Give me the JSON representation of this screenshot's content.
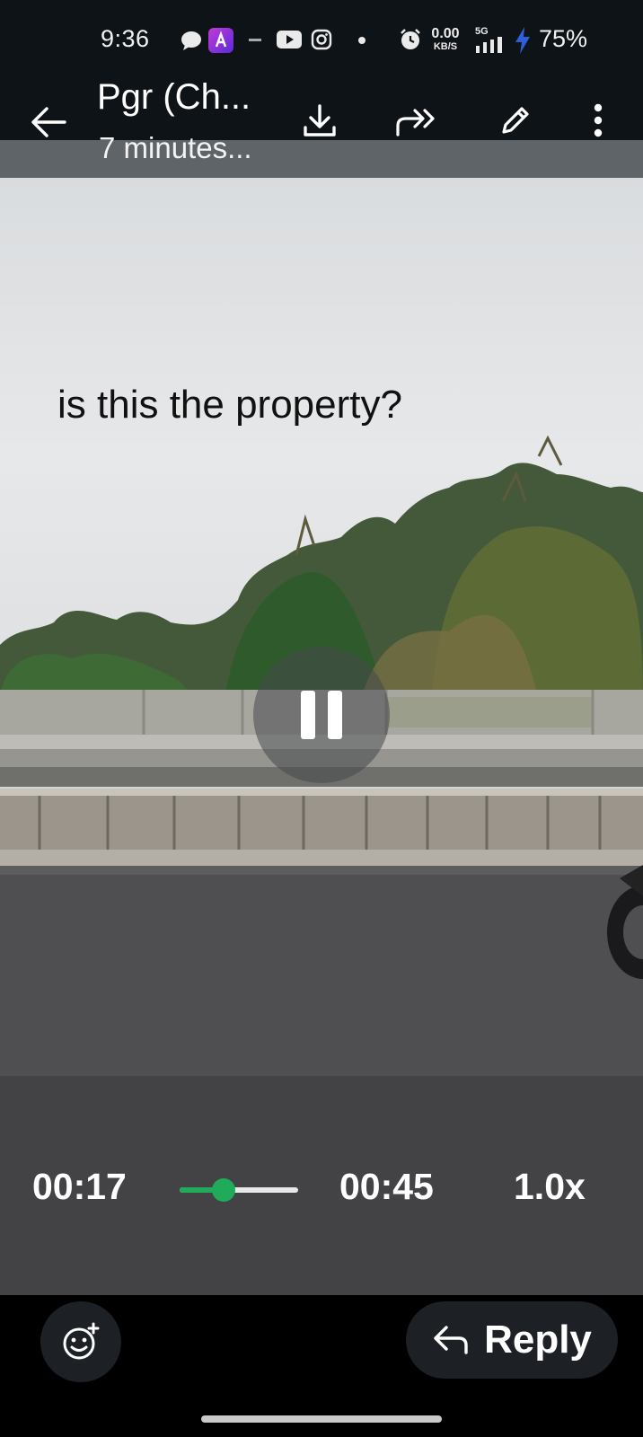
{
  "status_bar": {
    "time": "9:36",
    "network_speed": "0.00",
    "network_unit": "KB/S",
    "network_type": "5G",
    "battery": "75%",
    "icons": [
      "chat-bubble-icon",
      "app-icon",
      "dash-icon",
      "youtube-icon",
      "instagram-icon",
      "dot-icon",
      "alarm-icon",
      "signal-icon",
      "charging-icon"
    ]
  },
  "toolbar": {
    "title": "Pgr (Ch...",
    "subtitle": "7 minutes...",
    "icons": [
      "back-arrow-icon",
      "download-icon",
      "forward-icon",
      "edit-icon",
      "more-vert-icon"
    ]
  },
  "video": {
    "caption": "is this the property?",
    "current_time": "00:17",
    "duration": "00:45",
    "speed": "1.0x",
    "progress": 0.37
  },
  "bottom_bar": {
    "reply_label": "Reply",
    "icons": [
      "emoji-add-icon",
      "reply-icon"
    ]
  },
  "colors": {
    "accent_green": "#1fab5a",
    "bar_background": "#0e1318",
    "bottom_background": "#000000"
  }
}
